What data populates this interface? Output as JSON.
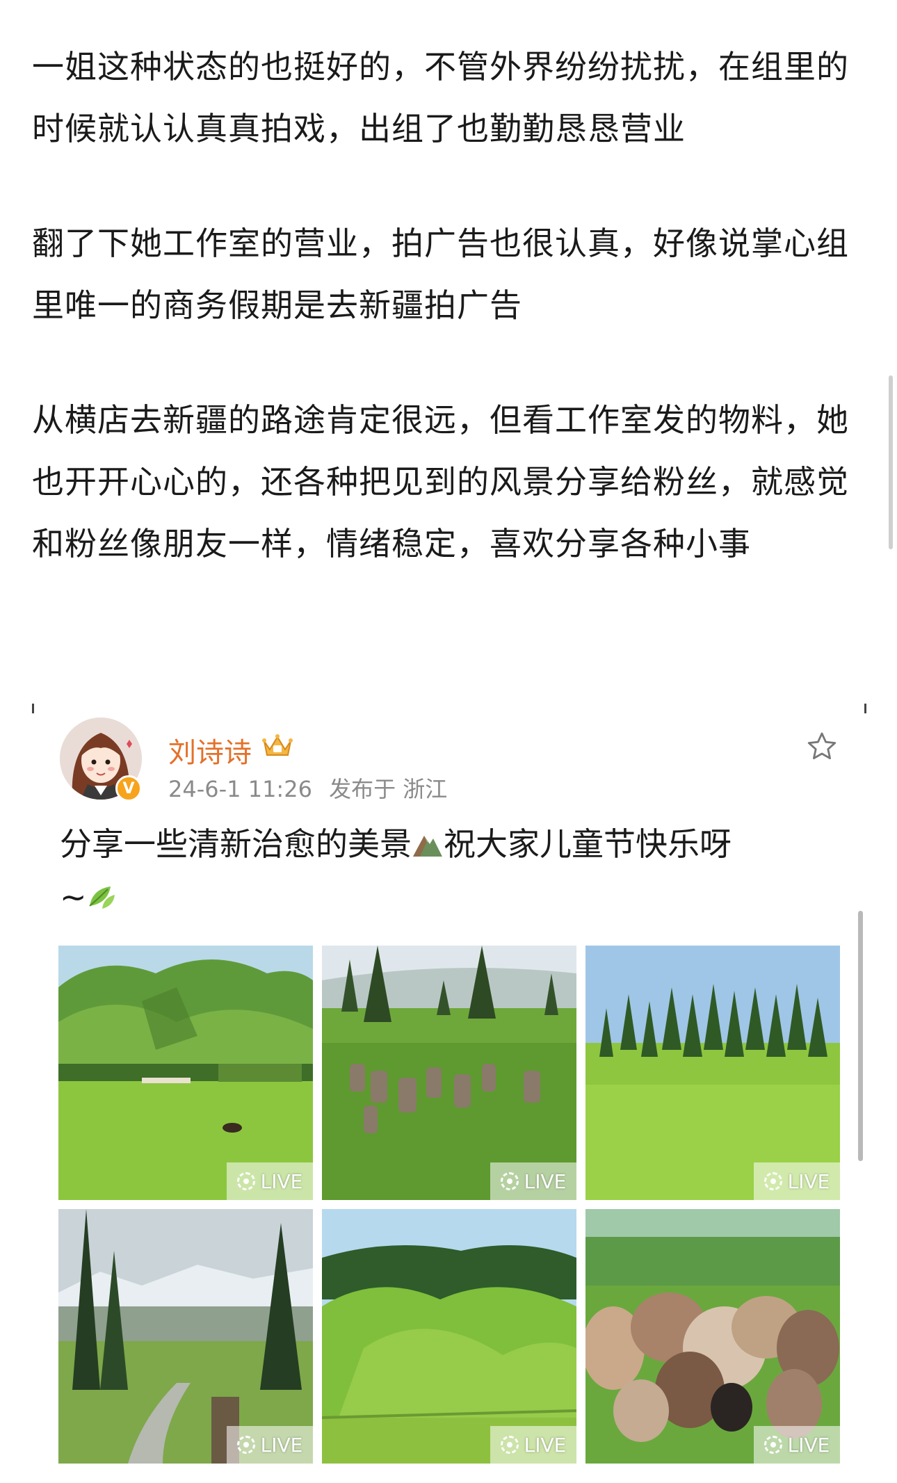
{
  "article": {
    "paragraphs": [
      "一姐这种状态的也挺好的，不管外界纷纷扰扰，在组里的时候就认认真真拍戏，出组了也勤勤恳恳营业",
      "翻了下她工作室的营业，拍广告也很认真，好像说掌心组里唯一的商务假期是去新疆拍广告",
      "从横店去新疆的路途肯定很远，但看工作室发的物料，她也开开心心的，还各种把见到的风景分享给粉丝，就感觉和粉丝像朋友一样，情绪稳定，喜欢分享各种小事"
    ]
  },
  "post": {
    "username": "刘诗诗",
    "date": "24-6-1 11:26",
    "location": "发布于 浙江",
    "text": "分享一些清新治愈的美景",
    "text2": "祝大家儿童节快乐呀",
    "text3": "~",
    "verified_label": "V",
    "live_label": "LIVE",
    "images": [
      {
        "icon": "grassland-hills-photo"
      },
      {
        "icon": "cattle-meadow-photo"
      },
      {
        "icon": "spruce-forest-photo"
      },
      {
        "icon": "mountain-stream-photo"
      },
      {
        "icon": "green-hills-photo"
      },
      {
        "icon": "sheep-flock-photo"
      }
    ],
    "colors": {
      "username": "#e4702a",
      "verified": "#f7a31c",
      "grass": "#7cbb3a"
    }
  }
}
